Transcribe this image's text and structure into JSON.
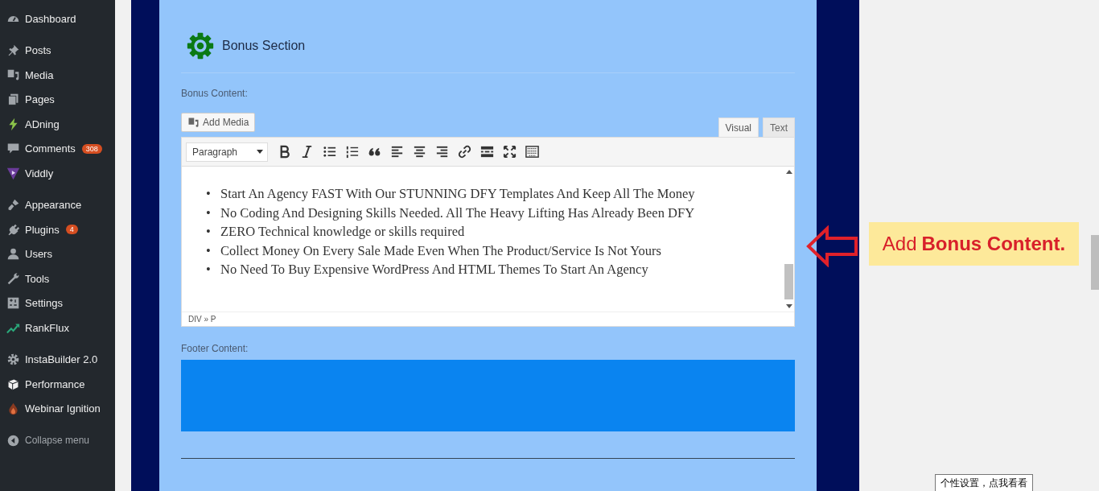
{
  "sidebar": {
    "groups": [
      {
        "items": [
          {
            "kind": "dashboard",
            "label": "Dashboard"
          }
        ]
      },
      {
        "items": [
          {
            "kind": "pin",
            "label": "Posts"
          },
          {
            "kind": "media",
            "label": "Media"
          },
          {
            "kind": "pages",
            "label": "Pages"
          },
          {
            "kind": "bolt",
            "label": "ADning"
          },
          {
            "kind": "comment",
            "label": "Comments",
            "badge": "308"
          },
          {
            "kind": "play",
            "label": "Viddly"
          }
        ]
      },
      {
        "items": [
          {
            "kind": "brush",
            "label": "Appearance"
          },
          {
            "kind": "plug",
            "label": "Plugins",
            "badge": "4"
          },
          {
            "kind": "user",
            "label": "Users"
          },
          {
            "kind": "wrench",
            "label": "Tools"
          },
          {
            "kind": "settings",
            "label": "Settings"
          },
          {
            "kind": "trend",
            "label": "RankFlux"
          }
        ]
      },
      {
        "items": [
          {
            "kind": "gear",
            "label": "InstaBuilder 2.0"
          },
          {
            "kind": "cube",
            "label": "Performance"
          },
          {
            "kind": "flame",
            "label": "Webinar Ignition"
          }
        ]
      }
    ],
    "collapse_menu": {
      "label": "Collapse menu"
    }
  },
  "section": {
    "title": "Bonus Section"
  },
  "bonus_field": {
    "label": "Bonus Content:",
    "add_media": "Add Media",
    "tabs": [
      {
        "label": "Visual",
        "selected": true
      },
      {
        "label": "Text",
        "selected": false
      }
    ],
    "format_select": "Paragraph",
    "bullets": [
      {
        "marker": "•",
        "text": "Start An Agency FAST With Our STUNNING DFY Templates And Keep All The Money"
      },
      {
        "marker": "•",
        "text": "No Coding And Designing Skills Needed. All The Heavy Lifting Has Already Been DFY"
      },
      {
        "marker": "•",
        "text": "ZERO Technical knowledge or skills required"
      },
      {
        "marker": "•",
        "text": "Collect Money On Every Sale Made Even When The Product/Service Is Not Yours"
      },
      {
        "marker": "•",
        "text": "No Need To Buy Expensive WordPress And HTML Themes To Start An Agency"
      }
    ],
    "path": "DIV » P"
  },
  "footer_field": {
    "label": "Footer Content:"
  },
  "callout": {
    "prefix": "Add",
    "emphasis": "Bonus Content."
  },
  "tooltip": "个性设置，点我看看"
}
